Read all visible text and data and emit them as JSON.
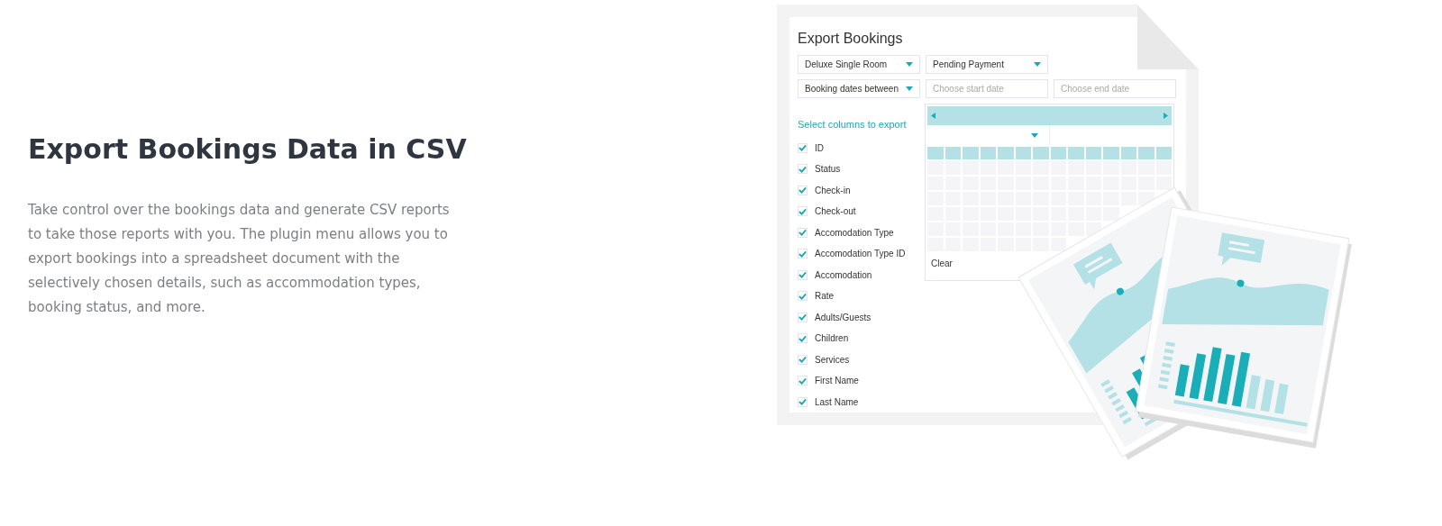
{
  "heading": "Export Bookings Data in CSV",
  "description": "Take control over the bookings data and generate CSV reports to take those reports with you. The plugin menu allows you to export bookings into a spreadsheet document with the selectively chosen details, such as accommodation types, booking status, and more.",
  "panel": {
    "title": "Export Bookings",
    "selects": [
      {
        "value": "Deluxe Single Room"
      },
      {
        "value": "Pending Payment"
      },
      {
        "value": "Booking dates between"
      }
    ],
    "date_fields": [
      {
        "placeholder": "Choose start date"
      },
      {
        "placeholder": "Choose end date"
      }
    ],
    "columns_label": "Select columns to export",
    "columns": [
      {
        "label": "ID",
        "checked": true
      },
      {
        "label": "Status",
        "checked": true
      },
      {
        "label": "Check-in",
        "checked": true
      },
      {
        "label": "Check-out",
        "checked": true
      },
      {
        "label": "Accomodation Type",
        "checked": true
      },
      {
        "label": "Accomodation Type ID",
        "checked": true
      },
      {
        "label": "Accomodation",
        "checked": true
      },
      {
        "label": "Rate",
        "checked": true
      },
      {
        "label": "Adults/Guests",
        "checked": true
      },
      {
        "label": "Children",
        "checked": true
      },
      {
        "label": "Services",
        "checked": true
      },
      {
        "label": "First Name",
        "checked": true
      },
      {
        "label": "Last Name",
        "checked": true
      }
    ],
    "calendar": {
      "clear": "Clear"
    }
  }
}
